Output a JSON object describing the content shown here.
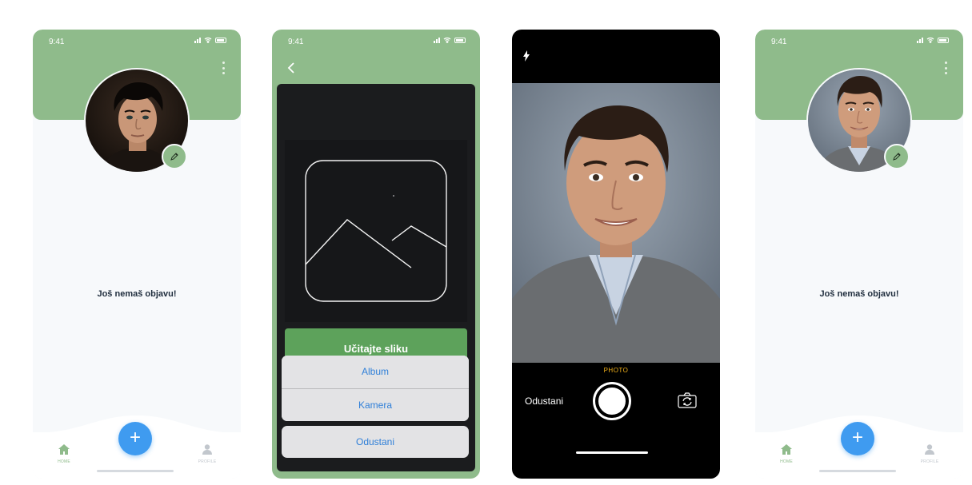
{
  "screens": {
    "profile_empty": {
      "status_time": "9:41",
      "empty_message": "Još nemaš objavu!",
      "tabs": {
        "home": "HOME",
        "profile": "PROFILE"
      },
      "fab_label": "+"
    },
    "upload": {
      "status_time": "9:41",
      "upload_button": "Učitajte sliku",
      "sheet_options": [
        "Album",
        "Kamera"
      ],
      "sheet_cancel": "Odustani"
    },
    "camera": {
      "mode_label": "PHOTO",
      "cancel_label": "Odustani"
    },
    "profile_updated": {
      "status_time": "9:41",
      "empty_message": "Još nemaš objavu!",
      "tabs": {
        "home": "HOME",
        "profile": "PROFILE"
      },
      "fab_label": "+"
    }
  },
  "colors": {
    "header_green": "#8fbb8b",
    "button_green": "#5da25b",
    "fab_blue": "#3f9bf0",
    "ios_blue": "#2f7fd8",
    "camera_mode_yellow": "#f3b21a"
  },
  "icons": [
    "more-vertical-icon",
    "pencil-icon",
    "home-icon",
    "user-icon",
    "plus-icon",
    "chevron-left-icon",
    "image-placeholder-icon",
    "flash-icon",
    "camera-flip-icon"
  ]
}
